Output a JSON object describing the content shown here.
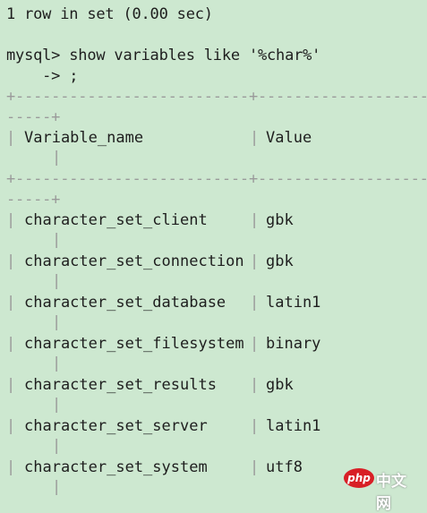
{
  "terminal": {
    "status_line": "1 row in set (0.00 sec)",
    "prompt_line": "mysql> show variables like '%char%'",
    "continuation_line": "    -> ;",
    "border_top": "+--------------------------+--------------------",
    "border_wrap": "-----+",
    "header": {
      "left_bar": "|",
      "name": "Variable_name",
      "mid_bar": "|",
      "value": "Value",
      "right_bar": "|"
    },
    "rows": [
      {
        "name": "character_set_client",
        "value": "gbk"
      },
      {
        "name": "character_set_connection",
        "value": "gbk"
      },
      {
        "name": "character_set_database",
        "value": "latin1"
      },
      {
        "name": "character_set_filesystem",
        "value": "binary"
      },
      {
        "name": "character_set_results",
        "value": "gbk"
      },
      {
        "name": "character_set_server",
        "value": "latin1"
      },
      {
        "name": "character_set_system",
        "value": "utf8"
      }
    ]
  },
  "watermark": {
    "badge": "php",
    "text": "中文网"
  },
  "colors": {
    "background": "#cde8d0",
    "text": "#1e1e1e",
    "border": "#9a9a9a"
  }
}
